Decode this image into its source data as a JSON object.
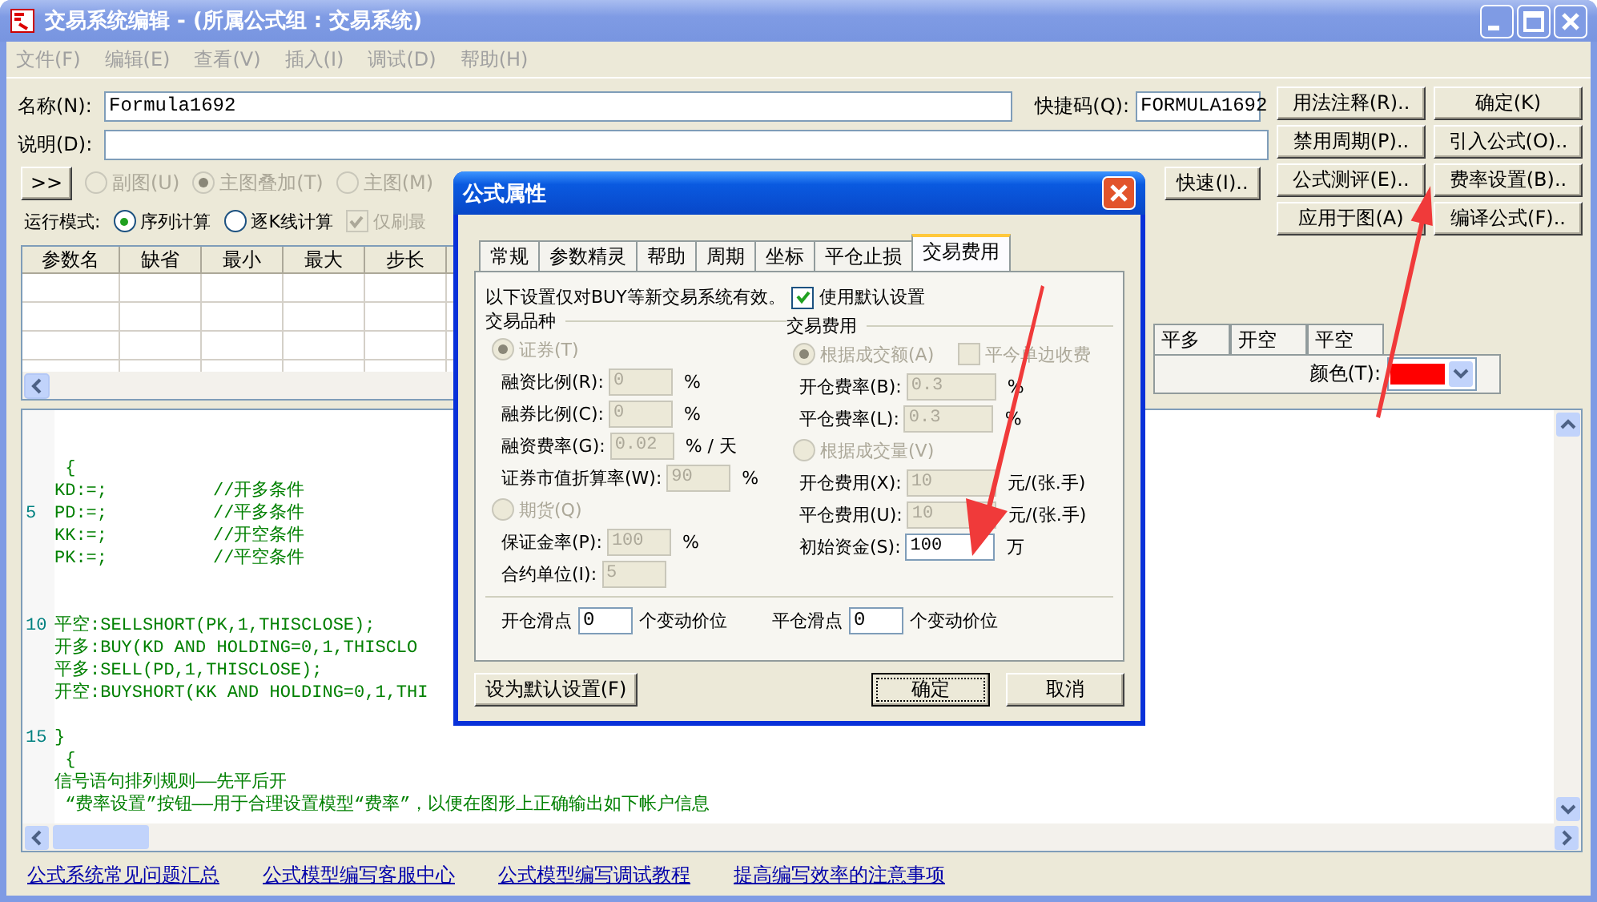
{
  "window": {
    "title": "交易系统编辑 - (所属公式组 : 交易系统)"
  },
  "menu": [
    {
      "label": "文件(F)"
    },
    {
      "label": "编辑(E)"
    },
    {
      "label": "查看(V)"
    },
    {
      "label": "插入(I)"
    },
    {
      "label": "调试(D)"
    },
    {
      "label": "帮助(H)"
    }
  ],
  "form": {
    "name": {
      "label": "名称(N):",
      "value": "Formula1692"
    },
    "shortcut": {
      "label": "快捷码(Q):",
      "value": "FORMULA1692"
    },
    "description": {
      "label": "说明(D):"
    },
    "expand_button": ">>",
    "chart_type": [
      {
        "label": "副图(U)",
        "selected": false,
        "disabled": true
      },
      {
        "label": "主图叠加(T)",
        "selected": true,
        "disabled": true
      },
      {
        "label": "主图(M)",
        "selected": false,
        "disabled": true
      }
    ],
    "quick_button": "快速(I)..",
    "run_mode": {
      "label": "运行模式:",
      "options": [
        {
          "label": "序列计算",
          "selected": true,
          "disabled": false
        },
        {
          "label": "逐K线计算",
          "selected": false,
          "disabled": false
        }
      ],
      "refresh": {
        "label": "仅刷最",
        "checked": true,
        "disabled": true
      }
    }
  },
  "side_buttons": [
    "用法注释(R)..",
    "确定(K)",
    "禁用周期(P)..",
    "引入公式(O)..",
    "公式测评(E)..",
    "费率设置(B)..",
    "应用于图(A)",
    "编译公式(F).."
  ],
  "param_table": {
    "columns": [
      "参数名",
      "缺省",
      "最小",
      "最大",
      "步长"
    ]
  },
  "signal_tabs": [
    {
      "label": "平多",
      "selected": false
    },
    {
      "label": "开空",
      "selected": false
    },
    {
      "label": "平空",
      "selected": false
    }
  ],
  "color_field": {
    "label": "颜色(T):",
    "color": "#ff0000"
  },
  "editor": {
    "lines": [
      {
        "kind": "blank"
      },
      {
        "kind": "blank"
      },
      {
        "kind": "code",
        "text": " {"
      },
      {
        "kind": "code",
        "text": "KD:=;          //开多条件"
      },
      {
        "kind": "code",
        "number": "5",
        "text": "PD:=;          //平多条件"
      },
      {
        "kind": "code",
        "text": "KK:=;          //开空条件"
      },
      {
        "kind": "code",
        "text": "PK:=;          //平空条件"
      },
      {
        "kind": "blank"
      },
      {
        "kind": "blank"
      },
      {
        "kind": "code",
        "number": "10",
        "text": "平空:SELLSHORT(PK,1,THISCLOSE);"
      },
      {
        "kind": "code",
        "text": "开多:BUY(KD AND HOLDING=0,1,THISCLO"
      },
      {
        "kind": "code",
        "text": "平多:SELL(PD,1,THISCLOSE);"
      },
      {
        "kind": "code",
        "text": "开空:BUYSHORT(KK AND HOLDING=0,1,THI"
      },
      {
        "kind": "blank"
      },
      {
        "kind": "code",
        "number": "15",
        "text": "}"
      },
      {
        "kind": "code",
        "text": " {"
      },
      {
        "kind": "code",
        "text": "信号语句排列规则——先平后开"
      },
      {
        "kind": "code",
        "text": " “费率设置”按钮——用于合理设置模型“费率”，以便在图形上正确输出如下帐户信息"
      }
    ]
  },
  "links": [
    "公式系统常见问题汇总",
    "公式模型编写客服中心",
    "公式模型编写调试教程",
    "提高编写效率的注意事项"
  ],
  "dialog": {
    "title": "公式属性",
    "tabs": [
      {
        "label": "常规",
        "selected": false
      },
      {
        "label": "参数精灵",
        "selected": false
      },
      {
        "label": "帮助",
        "selected": false
      },
      {
        "label": "周期",
        "selected": false
      },
      {
        "label": "坐标",
        "selected": false
      },
      {
        "label": "平仓止损",
        "selected": false
      },
      {
        "label": "交易费用",
        "selected": true
      }
    ],
    "notice": "以下设置仅对BUY等新交易系统有效。",
    "use_default": {
      "label": "使用默认设置",
      "checked": true
    },
    "groups": [
      {
        "title": "交易品种",
        "items": [
          {
            "kind": "radio",
            "label": "证券(T)",
            "selected": true,
            "disabled": true
          },
          {
            "kind": "field",
            "label": "融资比例(R):",
            "value": "0",
            "unit": "%",
            "disabled": true
          },
          {
            "kind": "field",
            "label": "融券比例(C):",
            "value": "0",
            "unit": "%",
            "disabled": true
          },
          {
            "kind": "field",
            "label": "融资费率(G):",
            "value": "0.02",
            "unit": "% / 天",
            "disabled": true
          },
          {
            "kind": "field",
            "label": "证券市值折算率(W):",
            "value": "90",
            "unit": "%",
            "disabled": true
          },
          {
            "kind": "radio",
            "label": "期货(Q)",
            "selected": false,
            "disabled": true
          },
          {
            "kind": "field",
            "label": "保证金率(P):",
            "value": "100",
            "unit": "%",
            "disabled": true
          },
          {
            "kind": "field",
            "label": "合约单位(I):",
            "value": "5",
            "disabled": true
          }
        ]
      },
      {
        "title": "交易费用",
        "items": [
          {
            "kind": "radio",
            "label": "根据成交额(A)",
            "selected": true,
            "disabled": true,
            "checkbox": {
              "label": "平今单边收费",
              "checked": false,
              "disabled": true
            }
          },
          {
            "kind": "field",
            "label": "开仓费率(B):",
            "value": "0.3",
            "unit": "%",
            "disabled": true
          },
          {
            "kind": "field",
            "label": "平仓费率(L):",
            "value": "0.3",
            "unit": "%",
            "disabled": true
          },
          {
            "kind": "radio",
            "label": "根据成交量(V)",
            "selected": false,
            "disabled": true
          },
          {
            "kind": "field",
            "label": "开仓费用(X):",
            "value": "10",
            "unit": "元/(张.手)",
            "disabled": true
          },
          {
            "kind": "field",
            "label": "平仓费用(U):",
            "value": "10",
            "unit": "元/(张.手)",
            "disabled": true
          },
          {
            "kind": "field",
            "label": "初始资金(S):",
            "value": "100",
            "unit": "万",
            "disabled": false
          }
        ]
      }
    ],
    "slippage": [
      {
        "label": "开仓滑点",
        "value": "0",
        "unit": "个变动价位"
      },
      {
        "label": "平仓滑点",
        "value": "0",
        "unit": "个变动价位"
      }
    ],
    "buttons": [
      {
        "label": "设为默认设置(F)",
        "default": false
      },
      {
        "label": "确定",
        "default": true
      },
      {
        "label": "取消",
        "default": false
      }
    ]
  }
}
